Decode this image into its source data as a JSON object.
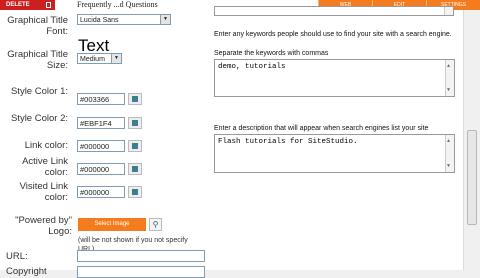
{
  "toolbar": {
    "delete_label": "DELETE",
    "faq_label": "Frequently ...d Questions",
    "tabs": [
      "WEB",
      "EDIT",
      "SETTINGS"
    ],
    "accent": "#f47c1e",
    "delete_color": "#cc1f1f"
  },
  "form": {
    "graphical_title_font_label": "Graphical Title Font:",
    "font_value": "Lucida Sans",
    "font_sample": "Text",
    "graphical_title_size_label": "Graphical Title Size:",
    "size_value": "Medium",
    "style_color1_label": "Style Color 1:",
    "style_color1_value": "#003366",
    "style_color2_label": "Style Color 2:",
    "style_color2_value": "#EBF1F4",
    "link_color_label": "Link color:",
    "link_color_value": "#000000",
    "active_link_label": "Active Link color:",
    "active_link_value": "#000000",
    "visited_link_label": "Visited Link color:",
    "visited_link_value": "#000000",
    "powered_by_label": "\"Powered by\" Logo:",
    "select_image_label": "Select Image",
    "powered_by_note": "(will be not shown if you not specify URL)",
    "url_label": "URL:",
    "copyright_label": "Copyright"
  },
  "seo": {
    "keywords_intro": "Enter any keywords people should use to find your site with a search engine.",
    "keywords_sep": "Separate the keywords with commas",
    "keywords_value": "demo, tutorials",
    "description_label": "Enter a description that will appear when search engines list your site",
    "description_value": "Flash tutorials for SiteStudio."
  }
}
